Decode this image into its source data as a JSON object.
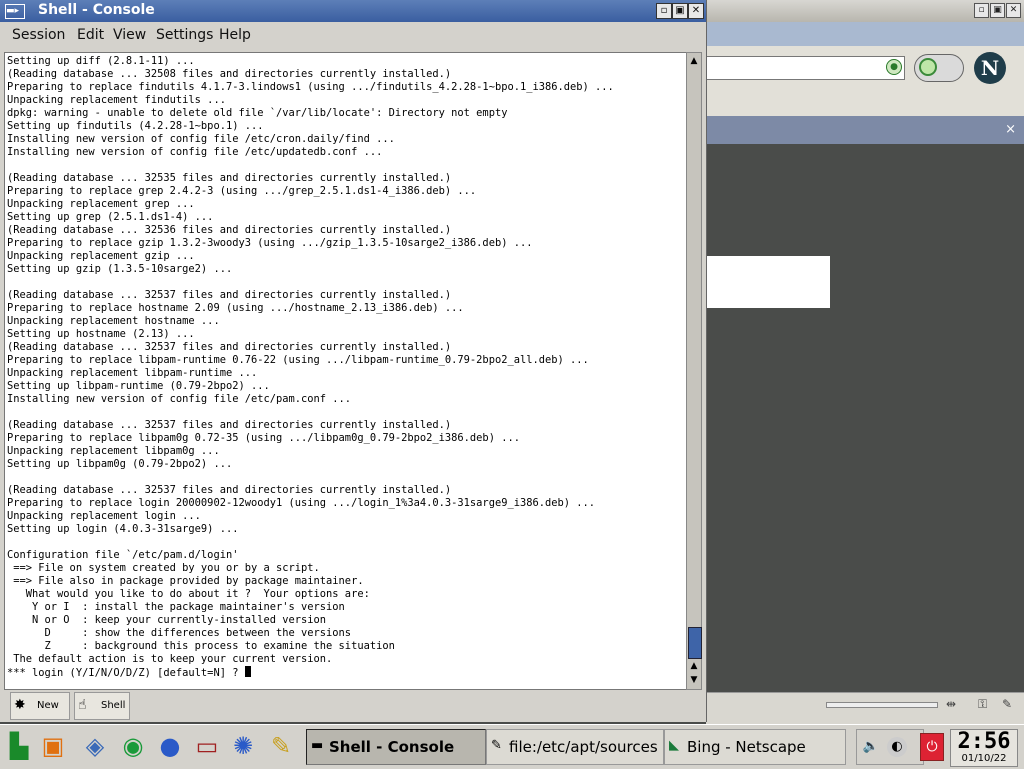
{
  "browser": {
    "logo_letter": "N",
    "close_x": "×"
  },
  "console": {
    "title": "Shell - Console",
    "menu": [
      "Session",
      "Edit",
      "View",
      "Settings",
      "Help"
    ],
    "lines": [
      "Setting up diff (2.8.1-11) ...",
      "(Reading database ... 32508 files and directories currently installed.)",
      "Preparing to replace findutils 4.1.7-3.lindows1 (using .../findutils_4.2.28-1~bpo.1_i386.deb) ...",
      "Unpacking replacement findutils ...",
      "dpkg: warning - unable to delete old file `/var/lib/locate': Directory not empty",
      "Setting up findutils (4.2.28-1~bpo.1) ...",
      "Installing new version of config file /etc/cron.daily/find ...",
      "Installing new version of config file /etc/updatedb.conf ...",
      "",
      "(Reading database ... 32535 files and directories currently installed.)",
      "Preparing to replace grep 2.4.2-3 (using .../grep_2.5.1.ds1-4_i386.deb) ...",
      "Unpacking replacement grep ...",
      "Setting up grep (2.5.1.ds1-4) ...",
      "(Reading database ... 32536 files and directories currently installed.)",
      "Preparing to replace gzip 1.3.2-3woody3 (using .../gzip_1.3.5-10sarge2_i386.deb) ...",
      "Unpacking replacement gzip ...",
      "Setting up gzip (1.3.5-10sarge2) ...",
      "",
      "(Reading database ... 32537 files and directories currently installed.)",
      "Preparing to replace hostname 2.09 (using .../hostname_2.13_i386.deb) ...",
      "Unpacking replacement hostname ...",
      "Setting up hostname (2.13) ...",
      "(Reading database ... 32537 files and directories currently installed.)",
      "Preparing to replace libpam-runtime 0.76-22 (using .../libpam-runtime_0.79-2bpo2_all.deb) ...",
      "Unpacking replacement libpam-runtime ...",
      "Setting up libpam-runtime (0.79-2bpo2) ...",
      "Installing new version of config file /etc/pam.conf ...",
      "",
      "(Reading database ... 32537 files and directories currently installed.)",
      "Preparing to replace libpam0g 0.72-35 (using .../libpam0g_0.79-2bpo2_i386.deb) ...",
      "Unpacking replacement libpam0g ...",
      "Setting up libpam0g (0.79-2bpo2) ...",
      "",
      "(Reading database ... 32537 files and directories currently installed.)",
      "Preparing to replace login 20000902-12woody1 (using .../login_1%3a4.0.3-31sarge9_i386.deb) ...",
      "Unpacking replacement login ...",
      "Setting up login (4.0.3-31sarge9) ...",
      "",
      "Configuration file `/etc/pam.d/login'",
      " ==> File on system created by you or by a script.",
      " ==> File also in package provided by package maintainer.",
      "   What would you like to do about it ?  Your options are:",
      "    Y or I  : install the package maintainer's version",
      "    N or O  : keep your currently-installed version",
      "      D     : show the differences between the versions",
      "      Z     : background this process to examine the situation",
      " The default action is to keep your current version.",
      "*** login (Y/I/N/O/D/Z) [default=N] ? "
    ],
    "tabs": [
      {
        "label": "New",
        "icon": "new-session-icon"
      },
      {
        "label": "Shell",
        "icon": "shell-icon"
      }
    ]
  },
  "taskbar": {
    "tasks": [
      {
        "label": "Shell - Console",
        "icon": "terminal-icon",
        "active": true
      },
      {
        "label": "file:/etc/apt/sources.list",
        "icon": "editor-icon",
        "active": false
      },
      {
        "label": "Bing - Netscape",
        "icon": "netscape-icon",
        "active": false
      }
    ],
    "clock": {
      "time": "2:56",
      "date": "01/10/22"
    }
  }
}
